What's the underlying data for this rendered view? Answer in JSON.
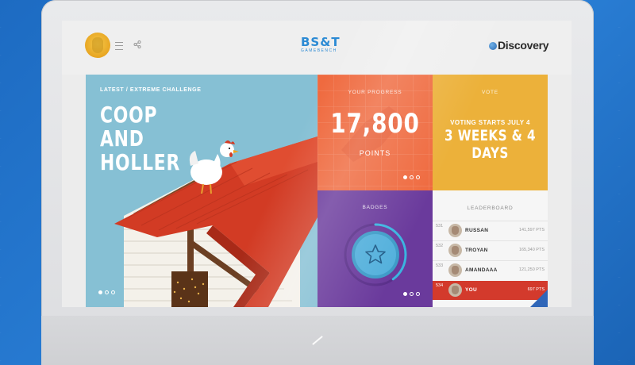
{
  "colors": {
    "background": "#1f6fc4",
    "hero": "#86c0d4",
    "progress": "#ef6a3f",
    "vote": "#ecb13a",
    "badges": "#6a3a9c",
    "leaderboard": "#f6f6f6",
    "leaderboard_highlight": "#d33a2c",
    "brand_blue": "#2b8ad4"
  },
  "header": {
    "logo_main": "BS&T",
    "logo_sub": "GAMEBENCH",
    "partner_logo": "Discovery",
    "icons": [
      "avatar",
      "menu-icon",
      "share-icon"
    ]
  },
  "hero": {
    "eyebrow": "LATEST / EXTREME CHALLENGE",
    "title": "COOP AND HOLLER",
    "pager": {
      "count": 3,
      "active": 0
    }
  },
  "progress": {
    "label": "YOUR PROGRESS",
    "value": "17,800",
    "unit": "POINTS",
    "pager": {
      "count": 3,
      "active": 0
    }
  },
  "vote": {
    "label": "VOTE",
    "line1": "VOTING STARTS JULY 4",
    "line2": "3 WEEKS & 4 DAYS"
  },
  "badges": {
    "label": "BADGES",
    "icon": "star-icon",
    "progress_fraction": 0.4,
    "pager": {
      "count": 3,
      "active": 0
    }
  },
  "leaderboard": {
    "label": "LEADERBOARD",
    "rows": [
      {
        "rank": "531",
        "name": "RUSSAN",
        "points": "141,597 PTS"
      },
      {
        "rank": "532",
        "name": "TROYAN",
        "points": "165,340 PTS"
      },
      {
        "rank": "533",
        "name": "AMANDAAA",
        "points": "121,250 PTS"
      },
      {
        "rank": "534",
        "name": "YOU",
        "points": "697 PTS"
      }
    ]
  }
}
